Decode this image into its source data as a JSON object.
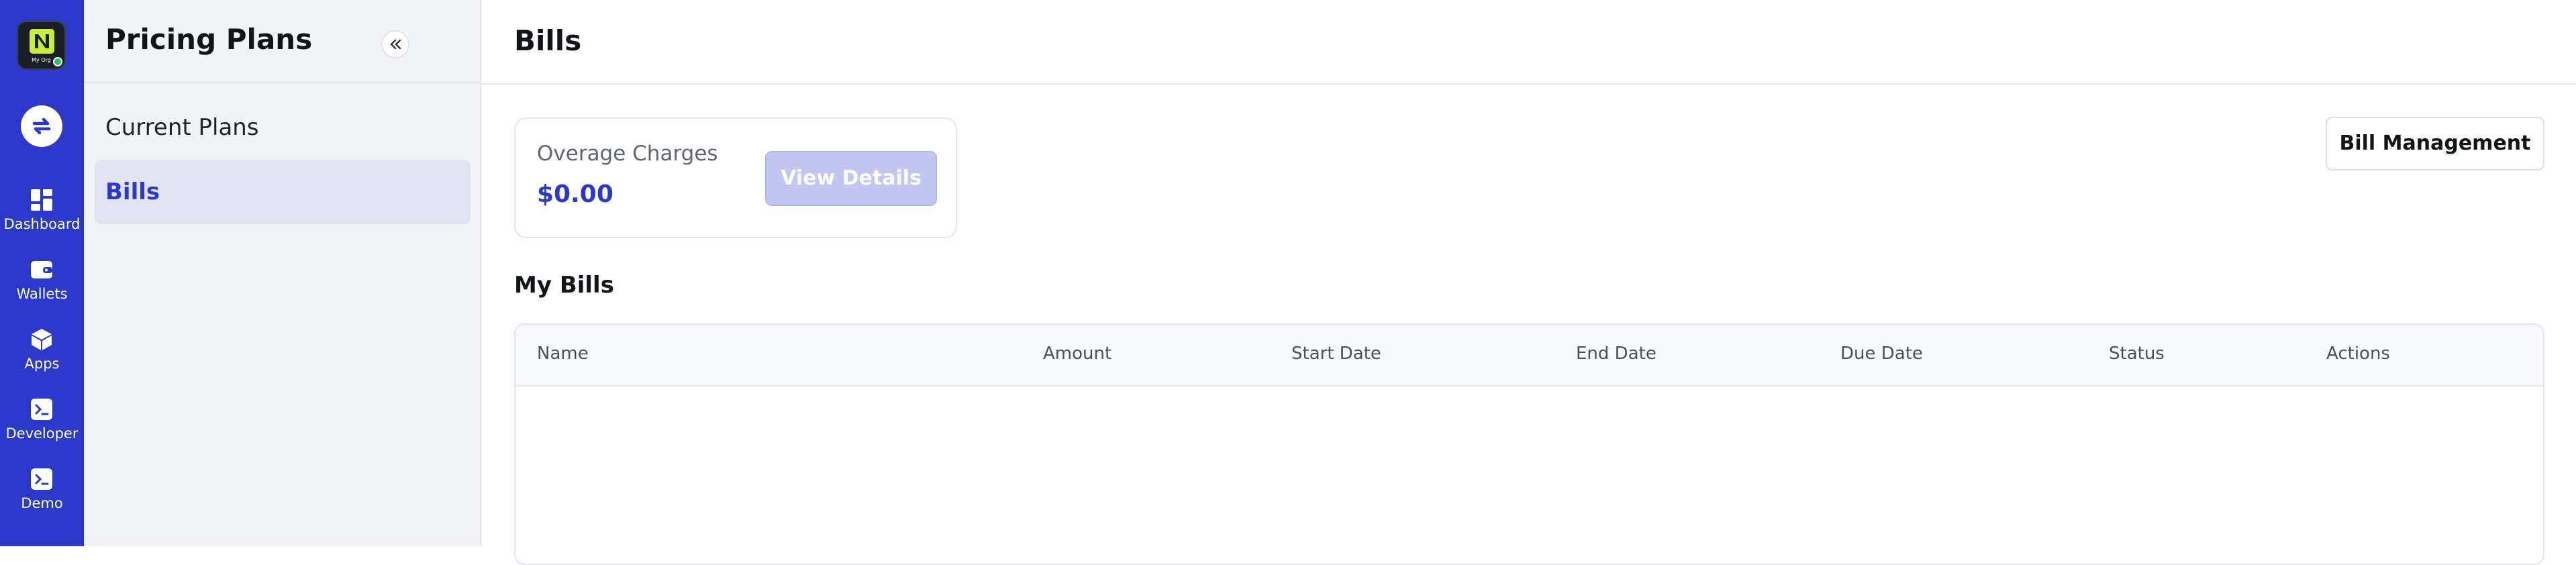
{
  "rail": {
    "org_name": "My Org",
    "items": [
      {
        "label": "Dashboard",
        "icon": "dashboard-icon"
      },
      {
        "label": "Wallets",
        "icon": "wallet-icon"
      },
      {
        "label": "Apps",
        "icon": "cube-icon"
      },
      {
        "label": "Developer",
        "icon": "terminal-icon"
      },
      {
        "label": "Demo",
        "icon": "terminal-icon"
      }
    ]
  },
  "sidebar": {
    "title": "Pricing Plans",
    "items": [
      {
        "label": "Current Plans",
        "active": false
      },
      {
        "label": "Bills",
        "active": true
      }
    ]
  },
  "main": {
    "title": "Bills",
    "overage": {
      "label": "Overage Charges",
      "value": "$0.00",
      "button": "View Details"
    },
    "bill_management_button": "Bill Management",
    "section_title": "My Bills",
    "table": {
      "columns": [
        "Name",
        "Amount",
        "Start Date",
        "End Date",
        "Due Date",
        "Status",
        "Actions"
      ],
      "rows": []
    }
  },
  "colors": {
    "brand": "#2b38c9",
    "sidebar_bg": "#f2f3f6",
    "active_item_bg": "#e2e4f2",
    "disabled_button": "#c3c6f1"
  }
}
